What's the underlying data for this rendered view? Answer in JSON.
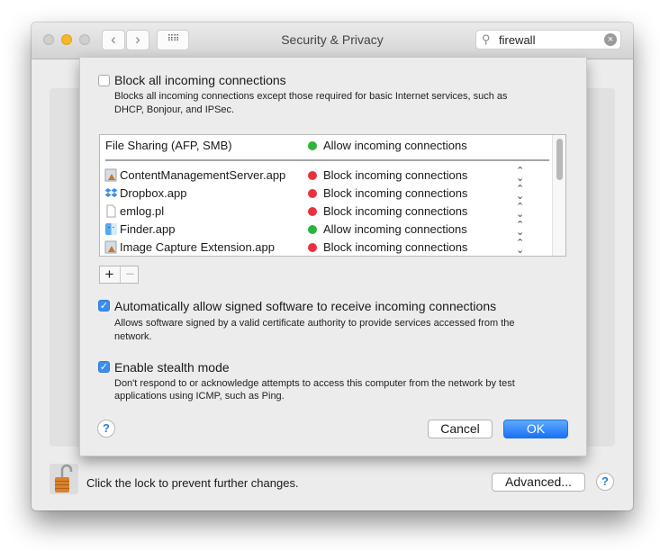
{
  "window": {
    "title": "Security & Privacy",
    "search": {
      "value": "firewall",
      "placeholder": "Search"
    }
  },
  "sheet": {
    "block_all": {
      "label": "Block all incoming connections",
      "checked": false,
      "description_line1": "Blocks all incoming connections except those required for basic Internet services,  such as",
      "description_line2": "DHCP, Bonjour, and IPSec."
    },
    "service_row": {
      "name": "File Sharing (AFP, SMB)",
      "status": "Allow incoming connections",
      "status_color": "#2db43a"
    },
    "apps": [
      {
        "name": "ContentManagementServer.app",
        "icon": "app-generic-icon",
        "status": "Block incoming connections",
        "status_color": "#e8333f"
      },
      {
        "name": "Dropbox.app",
        "icon": "dropbox-icon",
        "status": "Block incoming connections",
        "status_color": "#e8333f"
      },
      {
        "name": "emlog.pl",
        "icon": "document-icon",
        "status": "Block incoming connections",
        "status_color": "#e8333f"
      },
      {
        "name": "Finder.app",
        "icon": "finder-icon",
        "status": "Allow incoming connections",
        "status_color": "#2db43a"
      },
      {
        "name": "Image Capture Extension.app",
        "icon": "app-generic-icon",
        "status": "Block incoming connections",
        "status_color": "#e8333f"
      }
    ],
    "add_label": "+",
    "remove_label": "−",
    "signed_software": {
      "label": "Automatically allow signed software to receive incoming connections",
      "checked": true,
      "description_line1": "Allows software signed by a valid certificate authority to provide services accessed from the",
      "description_line2": "network."
    },
    "stealth": {
      "label": "Enable stealth mode",
      "checked": true,
      "description_line1": "Don't respond to or acknowledge attempts to access this computer from the network by test",
      "description_line2": "applications using ICMP, such as Ping."
    },
    "help_label": "?",
    "cancel_label": "Cancel",
    "ok_label": "OK"
  },
  "footer": {
    "lock_text": "Click the lock to prevent further changes.",
    "advanced_label": "Advanced...",
    "help_label": "?"
  },
  "colors": {
    "accent": "#1a72f3",
    "allow": "#2db43a",
    "block": "#e8333f"
  }
}
